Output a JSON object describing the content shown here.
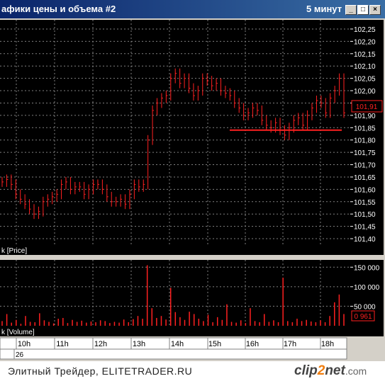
{
  "window": {
    "title": "афики цены и объема #2",
    "interval": "5 минут",
    "buttons": {
      "minimize": "_",
      "maximize": "□",
      "close": "×"
    }
  },
  "price_pane": {
    "label": "k [Price]",
    "y_ticks": [
      "102,25",
      "102,20",
      "102,15",
      "102,10",
      "102,05",
      "102,00",
      "101,95",
      "101,90",
      "101,85",
      "101,80",
      "101,75",
      "101,70",
      "101,65",
      "101,60",
      "101,55",
      "101,50",
      "101,45",
      "101,40"
    ],
    "current_price": "101,91",
    "support_level": 101.84
  },
  "volume_pane": {
    "label": "k [Volume]",
    "y_ticks": [
      "150 000",
      "100 000",
      "50 000"
    ],
    "current_volume": "0 961"
  },
  "time_axis": {
    "hours": [
      "10h",
      "11h",
      "12h",
      "13h",
      "14h",
      "15h",
      "16h",
      "17h",
      "18h"
    ],
    "date": "26"
  },
  "footer": {
    "credit": "Элитный Трейдер, ELITETRADER.RU",
    "logo_part1": "clip",
    "logo_part2": "2",
    "logo_part3": "net",
    "logo_suffix": ".com"
  },
  "colors": {
    "series": "#ff2020",
    "background": "#000000",
    "grid": "#808080",
    "axis_text": "#ffffff"
  },
  "chart_data": [
    {
      "type": "line",
      "title": "",
      "ylabel": "Price",
      "ylim": [
        101.38,
        102.27
      ],
      "y_ticks": [
        102.25,
        102.2,
        102.15,
        102.1,
        102.05,
        102.0,
        101.95,
        101.9,
        101.85,
        101.8,
        101.75,
        101.7,
        101.65,
        101.6,
        101.55,
        101.5,
        101.45,
        101.4
      ],
      "x_categories": [
        "10h",
        "11h",
        "12h",
        "13h",
        "14h",
        "15h",
        "16h",
        "17h",
        "18h"
      ],
      "series": [
        {
          "values": [
            101.63,
            101.64,
            101.62,
            101.58,
            101.56,
            101.54,
            101.52,
            101.5,
            101.51,
            101.55,
            101.56,
            101.57,
            101.58,
            101.62,
            101.63,
            101.6,
            101.61,
            101.61,
            101.58,
            101.6,
            101.62,
            101.62,
            101.6,
            101.57,
            101.55,
            101.55,
            101.56,
            101.54,
            101.58,
            101.62,
            101.61,
            101.62,
            101.8,
            101.92,
            101.95,
            101.97,
            101.98,
            102.05,
            102.07,
            102.03,
            102.05,
            102.01,
            101.98,
            102.0,
            102.05,
            102.04,
            102.02,
            102.03,
            102.0,
            101.99,
            101.98,
            101.95,
            101.93,
            101.9,
            101.91,
            101.93,
            101.92,
            101.88,
            101.86,
            101.85,
            101.87,
            101.84,
            101.82,
            101.85,
            101.88,
            101.89,
            101.86,
            101.9,
            101.93,
            101.96,
            101.95,
            101.91,
            101.97,
            102.0,
            102.05,
            101.91
          ]
        }
      ]
    },
    {
      "type": "bar",
      "title": "",
      "ylabel": "Volume",
      "ylim": [
        0,
        165000
      ],
      "y_ticks": [
        150000,
        100000,
        50000
      ],
      "x_categories": [
        "10h",
        "11h",
        "12h",
        "13h",
        "14h",
        "15h",
        "16h",
        "17h",
        "18h"
      ],
      "series": [
        {
          "values": [
            12000,
            30000,
            8000,
            15000,
            5000,
            25000,
            10000,
            9000,
            32000,
            14000,
            10000,
            6000,
            18000,
            20000,
            7000,
            15000,
            10000,
            13000,
            8000,
            11000,
            9000,
            14000,
            12000,
            7000,
            10000,
            8000,
            16000,
            9000,
            17000,
            25000,
            18000,
            155000,
            45000,
            20000,
            25000,
            16000,
            97000,
            35000,
            22000,
            15000,
            36000,
            30000,
            18000,
            12000,
            28000,
            9000,
            22000,
            15000,
            55000,
            10000,
            8000,
            14000,
            7000,
            45000,
            12000,
            9000,
            30000,
            10000,
            14000,
            9000,
            123000,
            12000,
            9000,
            18000,
            12000,
            15000,
            11000,
            9000,
            14000,
            9000,
            25000,
            60000,
            80000,
            30000
          ]
        }
      ]
    }
  ]
}
